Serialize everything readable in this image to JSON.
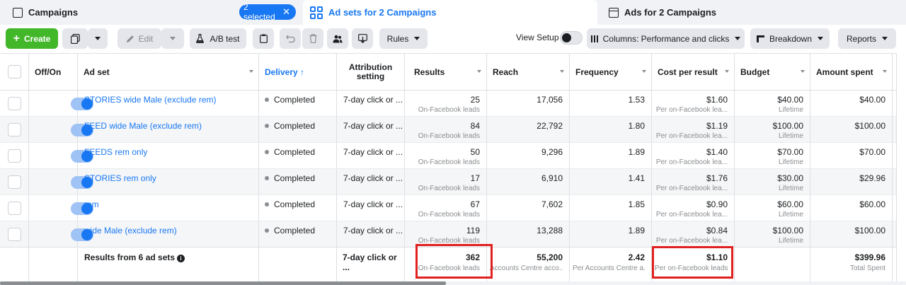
{
  "tabs": {
    "campaigns": {
      "label": "Campaigns",
      "selected_pill": "2 selected"
    },
    "adsets": {
      "label": "Ad sets for 2 Campaigns"
    },
    "ads": {
      "label": "Ads for 2 Campaigns"
    }
  },
  "toolbar": {
    "create": "Create",
    "edit": "Edit",
    "ab_test": "A/B test",
    "rules": "Rules",
    "view_setup": "View Setup",
    "columns": "Columns: Performance and clicks",
    "breakdown": "Breakdown",
    "reports": "Reports"
  },
  "headers": {
    "off_on": "Off/On",
    "ad_set": "Ad set",
    "delivery": "Delivery ↑",
    "attribution": "Attribution setting",
    "results": "Results",
    "reach": "Reach",
    "frequency": "Frequency",
    "cost_per_result": "Cost per result",
    "budget": "Budget",
    "amount_spent": "Amount spent"
  },
  "rows": [
    {
      "name": "STORIES wide Male (exclude rem)",
      "delivery": "Completed",
      "attribution": "7-day click or ...",
      "results": "25",
      "results_sub": "On-Facebook leads",
      "reach": "17,056",
      "frequency": "1.53",
      "cpr": "$1.60",
      "cpr_sub": "Per on-Facebook lea...",
      "budget": "$40.00",
      "budget_sub": "Lifetime",
      "spent": "$40.00"
    },
    {
      "name": "FEED wide Male (exclude rem)",
      "delivery": "Completed",
      "attribution": "7-day click or ...",
      "results": "84",
      "results_sub": "On-Facebook leads",
      "reach": "22,792",
      "frequency": "1.80",
      "cpr": "$1.19",
      "cpr_sub": "Per on-Facebook lea...",
      "budget": "$100.00",
      "budget_sub": "Lifetime",
      "spent": "$100.00"
    },
    {
      "name": "FEEDS rem only",
      "delivery": "Completed",
      "attribution": "7-day click or ...",
      "results": "50",
      "results_sub": "On-Facebook leads",
      "reach": "9,296",
      "frequency": "1.89",
      "cpr": "$1.40",
      "cpr_sub": "Per on-Facebook lea...",
      "budget": "$70.00",
      "budget_sub": "Lifetime",
      "spent": "$70.00"
    },
    {
      "name": "STORIES rem only",
      "delivery": "Completed",
      "attribution": "7-day click or ...",
      "results": "17",
      "results_sub": "On-Facebook leads",
      "reach": "6,910",
      "frequency": "1.41",
      "cpr": "$1.76",
      "cpr_sub": "Per on-Facebook lea...",
      "budget": "$30.00",
      "budget_sub": "Lifetime",
      "spent": "$29.96"
    },
    {
      "name": "rem",
      "delivery": "Completed",
      "attribution": "7-day click or ...",
      "results": "67",
      "results_sub": "On-Facebook leads",
      "reach": "7,602",
      "frequency": "1.85",
      "cpr": "$0.90",
      "cpr_sub": "Per on-Facebook lea...",
      "budget": "$60.00",
      "budget_sub": "Lifetime",
      "spent": "$60.00"
    },
    {
      "name": "wide Male (exclude rem)",
      "delivery": "Completed",
      "attribution": "7-day click or ...",
      "results": "119",
      "results_sub": "On-Facebook leads",
      "reach": "13,288",
      "frequency": "1.89",
      "cpr": "$0.84",
      "cpr_sub": "Per on-Facebook lea...",
      "budget": "$100.00",
      "budget_sub": "Lifetime",
      "spent": "$100.00"
    }
  ],
  "totals": {
    "label": "Results from 6 ad sets",
    "attribution": "7-day click or ...",
    "results": "362",
    "results_sub": "On-Facebook leads",
    "reach": "55,200",
    "reach_sub": "Accounts Centre acco...",
    "frequency": "2.42",
    "frequency_sub": "Per Accounts Centre a...",
    "cpr": "$1.10",
    "cpr_sub": "Per on-Facebook leads",
    "spent": "$399.96",
    "spent_sub": "Total Spent"
  },
  "colors": {
    "accent": "#1877f2",
    "create_green": "#42b72a",
    "highlight_red": "#e0211f"
  },
  "icons": {
    "campaigns_tab": "campaign-icon",
    "adsets_tab": "grid-icon",
    "ads_tab": "ad-icon"
  }
}
